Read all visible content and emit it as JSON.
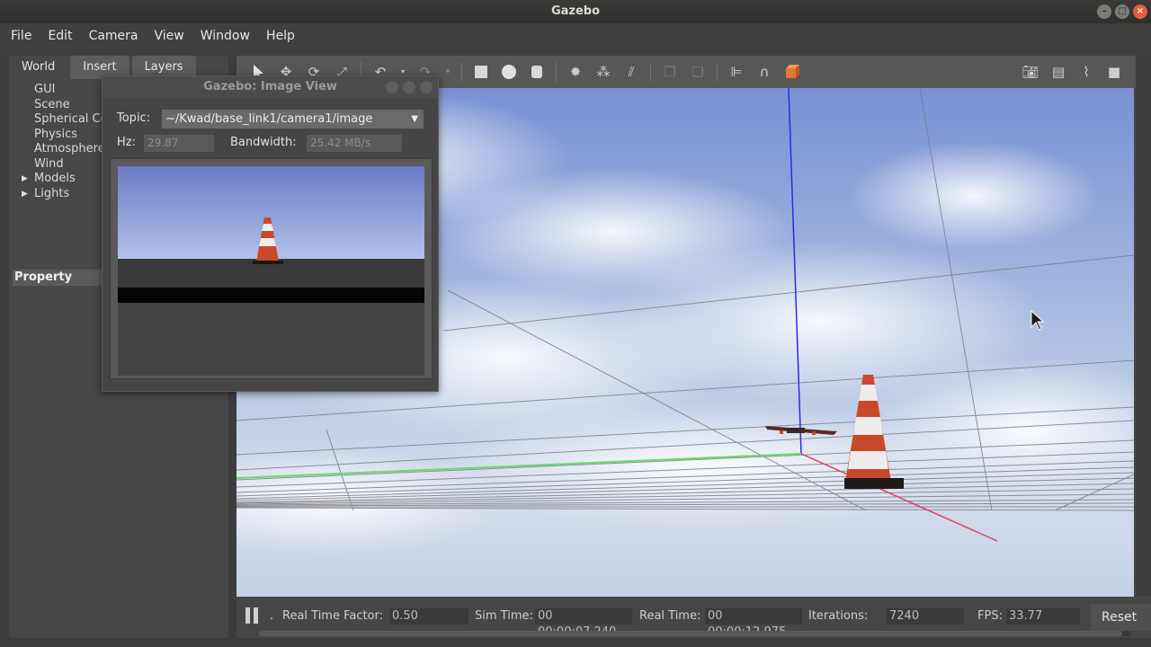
{
  "window": {
    "title": "Gazebo",
    "controls": [
      "minimize-icon",
      "maximize-icon",
      "close-icon"
    ]
  },
  "menubar": {
    "items": [
      {
        "label": "File"
      },
      {
        "label": "Edit"
      },
      {
        "label": "Camera"
      },
      {
        "label": "View"
      },
      {
        "label": "Window"
      },
      {
        "label": "Help"
      }
    ]
  },
  "left_panel": {
    "tabs": [
      {
        "label": "World",
        "active": true
      },
      {
        "label": "Insert",
        "active": false
      },
      {
        "label": "Layers",
        "active": false
      }
    ],
    "tree": [
      {
        "label": "GUI",
        "expandable": false
      },
      {
        "label": "Scene",
        "expandable": false
      },
      {
        "label": "Spherical Coordinates",
        "expandable": false
      },
      {
        "label": "Physics",
        "expandable": false
      },
      {
        "label": "Atmosphere",
        "expandable": false
      },
      {
        "label": "Wind",
        "expandable": false
      },
      {
        "label": "Models",
        "expandable": true
      },
      {
        "label": "Lights",
        "expandable": true
      }
    ],
    "property_header": "Property"
  },
  "toolbar": {
    "left_icons": [
      "select-arrow-icon",
      "translate-icon",
      "rotate-icon",
      "scale-icon",
      "undo-icon",
      "undo-dropdown-icon",
      "redo-icon",
      "redo-dropdown-icon",
      "box-icon",
      "sphere-icon",
      "cylinder-icon",
      "point-light-icon",
      "spot-light-icon",
      "directional-light-icon",
      "copy-icon",
      "paste-icon",
      "align-icon",
      "snap-magnet-icon",
      "view-angle-icon"
    ],
    "right_icons": [
      "screenshot-camera-icon",
      "log-icon",
      "plot-icon",
      "video-record-icon"
    ]
  },
  "image_view": {
    "title": "Gazebo: Image View",
    "topic_label": "Topic:",
    "topic_value": "~/Kwad/base_link1/camera1/image",
    "hz_label": "Hz:",
    "hz_value": "29.87",
    "bandwidth_label": "Bandwidth:",
    "bandwidth_value": "25.42 MB/s"
  },
  "statusbar": {
    "rtf_label": "Real Time Factor:",
    "rtf_value": "0.50",
    "sim_time_label": "Sim Time:",
    "sim_time_value": "00 00:00:07.240",
    "real_time_label": "Real Time:",
    "real_time_value": "00 00:00:12.975",
    "iterations_label": "Iterations:",
    "iterations_value": "7240",
    "fps_label": "FPS:",
    "fps_value": "33.77",
    "reset_label": "Reset",
    "step_marker": "."
  },
  "colors": {
    "x_axis": "#e0405a",
    "y_axis": "#66dd66",
    "z_axis": "#2222ee",
    "cone_orange": "#c8492a",
    "sky_blue": "#7b96d6"
  }
}
